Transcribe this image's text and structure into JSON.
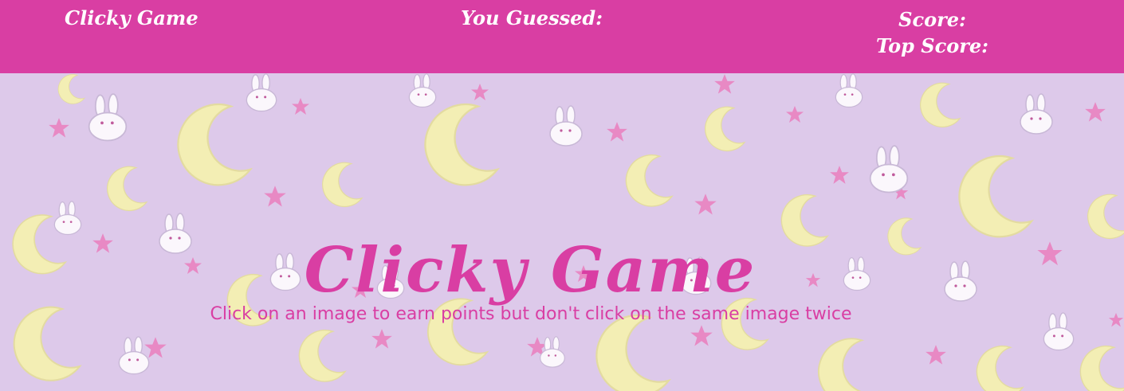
{
  "navbar": {
    "brand": "Clicky Game",
    "guess_label": "You Guessed:",
    "score_label": "Score:",
    "top_score_label": "Top Score:"
  },
  "hero": {
    "title": "Clicky Game",
    "subtitle": "Click on an image to earn points but don't click on the same image twice",
    "background_pattern": [
      "crescent-moon-icon",
      "bunny-icon",
      "star-icon"
    ]
  },
  "colors": {
    "primary": "#d93ea3",
    "background": "#ddc9ea",
    "moon": "#f3eeb4",
    "star": "#e889c4",
    "bunny": "#fbf7fc"
  }
}
